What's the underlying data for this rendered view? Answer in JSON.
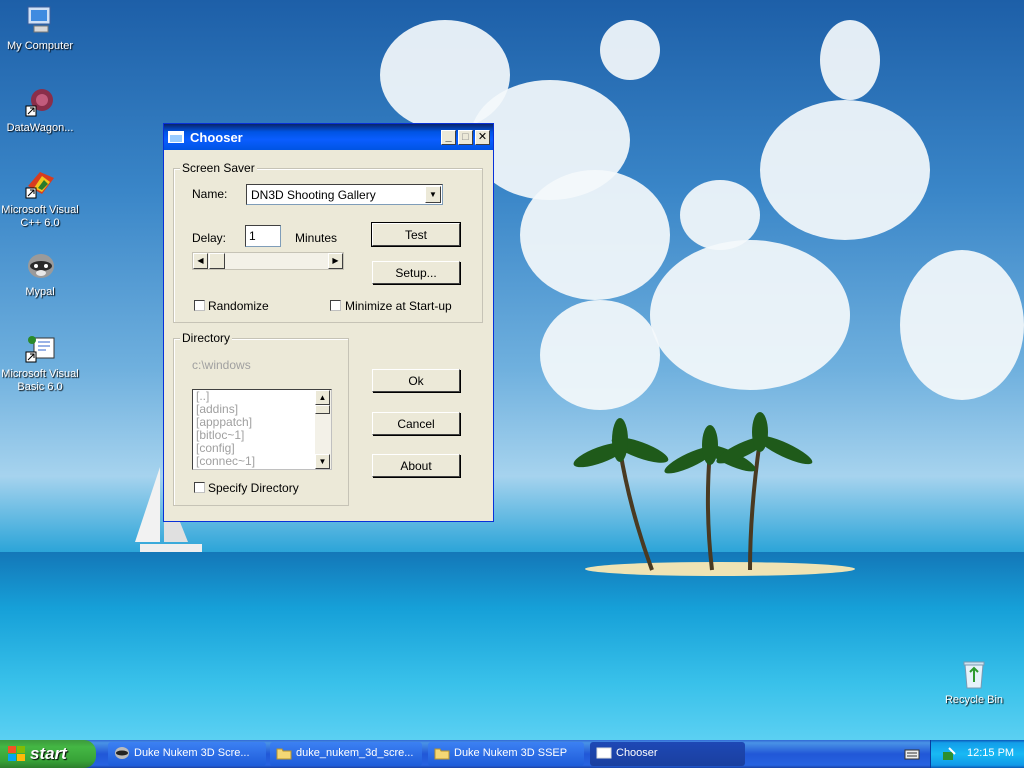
{
  "desktop": {
    "icons": [
      {
        "label": "My Computer"
      },
      {
        "label": "DataWagon..."
      },
      {
        "label": "Microsoft Visual C++ 6.0"
      },
      {
        "label": "Mypal"
      },
      {
        "label": "Microsoft Visual Basic 6.0"
      },
      {
        "label": "Recycle Bin"
      }
    ]
  },
  "window": {
    "title": "Chooser",
    "screen_saver": {
      "group_title": "Screen Saver",
      "name_label": "Name:",
      "name_value": "DN3D Shooting Gallery",
      "delay_label": "Delay:",
      "delay_value": "1",
      "delay_unit": "Minutes",
      "test_button": "Test",
      "setup_button": "Setup...",
      "randomize_label": "Randomize",
      "minimize_label": "Minimize at Start-up"
    },
    "directory": {
      "group_title": "Directory",
      "path": "c:\\windows",
      "entries": [
        "[..]",
        "[addins]",
        "[apppatch]",
        "[bitloc~1]",
        "[config]",
        "[connec~1]"
      ],
      "specify_label": "Specify Directory"
    },
    "ok_button": "Ok",
    "cancel_button": "Cancel",
    "about_button": "About"
  },
  "taskbar": {
    "start_label": "start",
    "tasks": [
      {
        "label": "Duke Nukem 3D Scre..."
      },
      {
        "label": "duke_nukem_3d_scre..."
      },
      {
        "label": "Duke Nukem 3D SSEP"
      },
      {
        "label": "Chooser"
      }
    ],
    "clock": "12:15 PM"
  }
}
